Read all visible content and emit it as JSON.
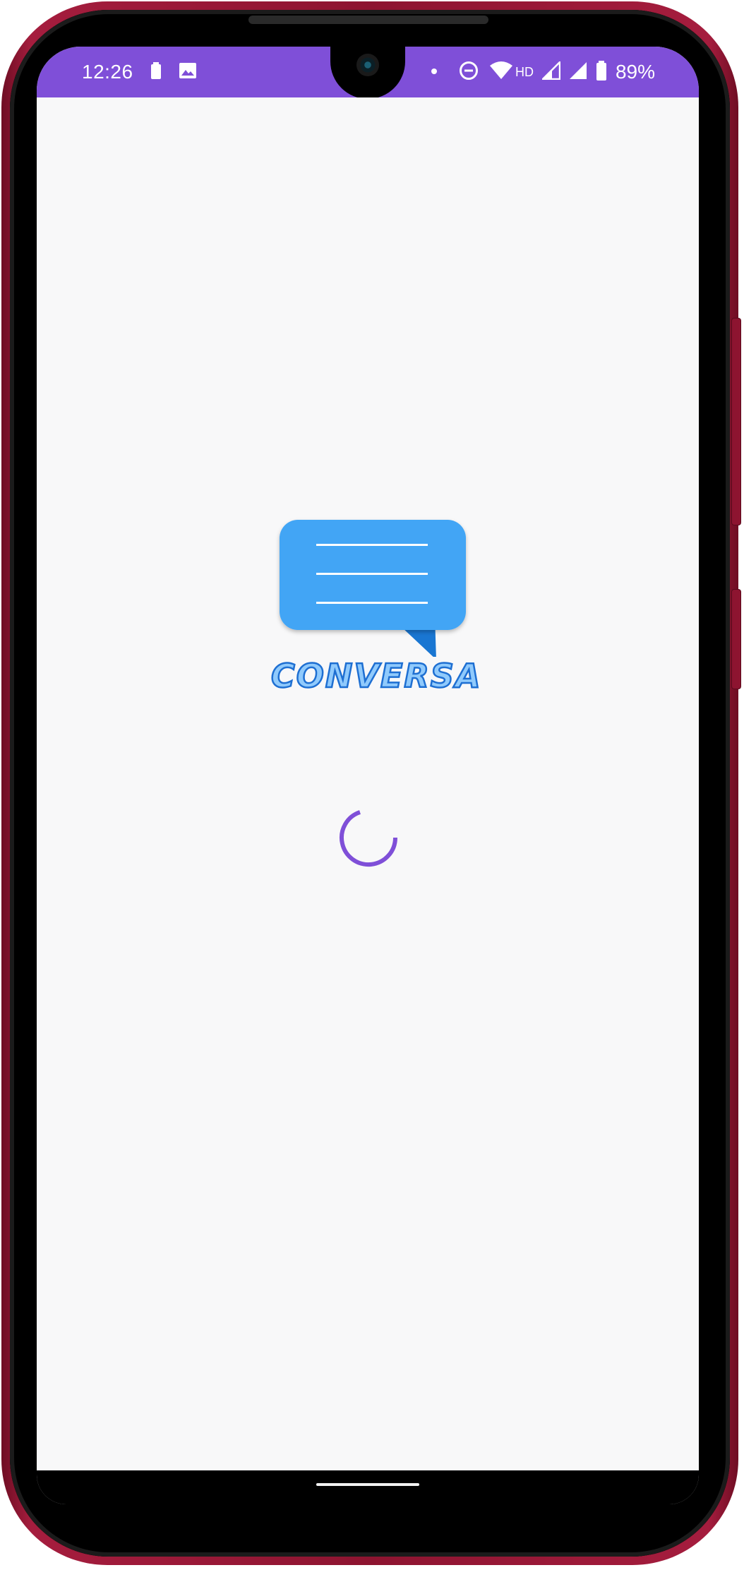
{
  "status_bar": {
    "time": "12:26",
    "network_label": "HD",
    "battery_percent": "89%",
    "background_color": "#7f4fd8",
    "icons": [
      "battery-saver-icon",
      "image-notification-icon",
      "dot-icon",
      "do-not-disturb-icon",
      "wifi-icon",
      "signal-icon",
      "signal-icon",
      "battery-icon"
    ]
  },
  "splash": {
    "app_name": "CONVERSA",
    "logo_icon": "chat-bubble-icon",
    "loading_indicator": "circular-progress-spinner",
    "accent_color": "#7f4fd8",
    "logo_colors": {
      "bubble": "#42a5f5",
      "tail": "#1976d2",
      "text_fill": "#90cafc",
      "text_stroke": "#1e6fd2"
    },
    "background_color": "#f8f8f9"
  }
}
